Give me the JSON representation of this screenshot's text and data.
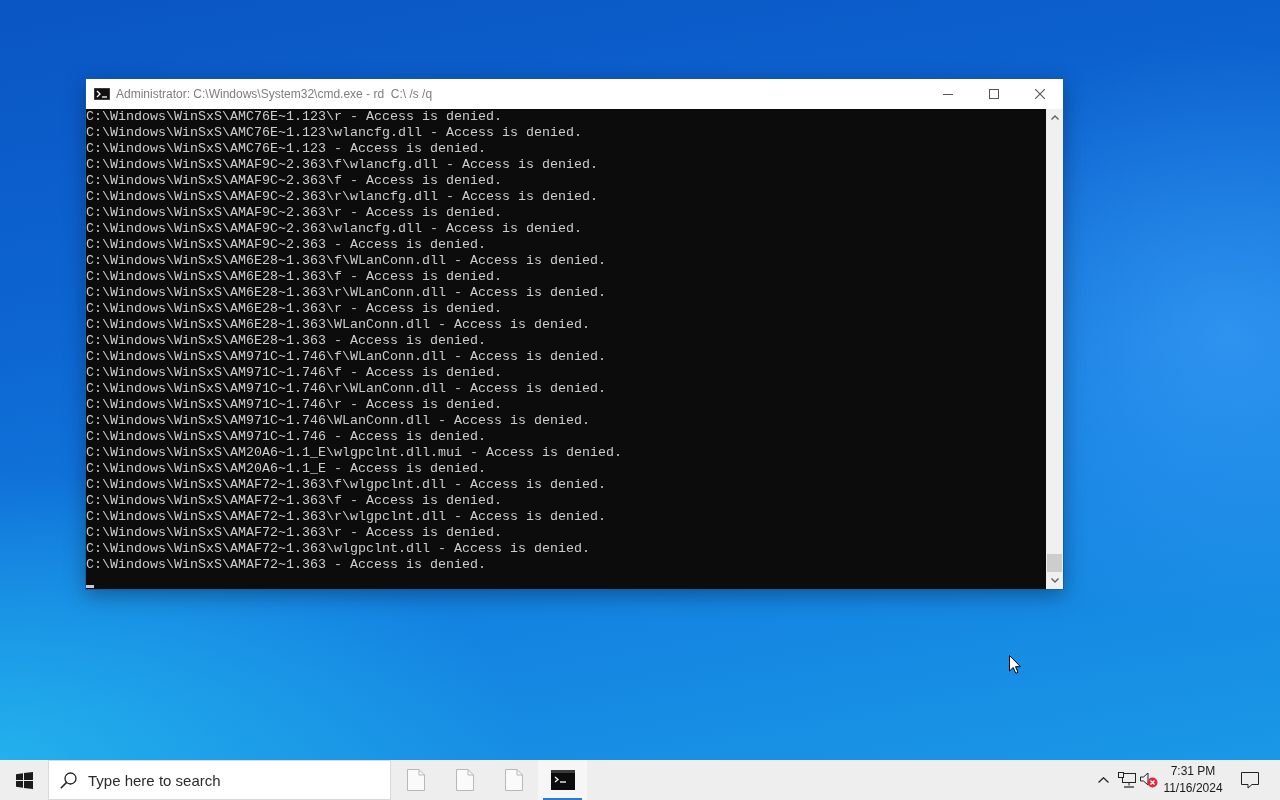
{
  "window": {
    "title": "Administrator: C:\\Windows\\System32\\cmd.exe - rd  C:\\ /s /q",
    "console_lines": [
      "C:\\Windows\\WinSxS\\AMC76E~1.123\\r - Access is denied.",
      "C:\\Windows\\WinSxS\\AMC76E~1.123\\wlancfg.dll - Access is denied.",
      "C:\\Windows\\WinSxS\\AMC76E~1.123 - Access is denied.",
      "C:\\Windows\\WinSxS\\AMAF9C~2.363\\f\\wlancfg.dll - Access is denied.",
      "C:\\Windows\\WinSxS\\AMAF9C~2.363\\f - Access is denied.",
      "C:\\Windows\\WinSxS\\AMAF9C~2.363\\r\\wlancfg.dll - Access is denied.",
      "C:\\Windows\\WinSxS\\AMAF9C~2.363\\r - Access is denied.",
      "C:\\Windows\\WinSxS\\AMAF9C~2.363\\wlancfg.dll - Access is denied.",
      "C:\\Windows\\WinSxS\\AMAF9C~2.363 - Access is denied.",
      "C:\\Windows\\WinSxS\\AM6E28~1.363\\f\\WLanConn.dll - Access is denied.",
      "C:\\Windows\\WinSxS\\AM6E28~1.363\\f - Access is denied.",
      "C:\\Windows\\WinSxS\\AM6E28~1.363\\r\\WLanConn.dll - Access is denied.",
      "C:\\Windows\\WinSxS\\AM6E28~1.363\\r - Access is denied.",
      "C:\\Windows\\WinSxS\\AM6E28~1.363\\WLanConn.dll - Access is denied.",
      "C:\\Windows\\WinSxS\\AM6E28~1.363 - Access is denied.",
      "C:\\Windows\\WinSxS\\AM971C~1.746\\f\\WLanConn.dll - Access is denied.",
      "C:\\Windows\\WinSxS\\AM971C~1.746\\f - Access is denied.",
      "C:\\Windows\\WinSxS\\AM971C~1.746\\r\\WLanConn.dll - Access is denied.",
      "C:\\Windows\\WinSxS\\AM971C~1.746\\r - Access is denied.",
      "C:\\Windows\\WinSxS\\AM971C~1.746\\WLanConn.dll - Access is denied.",
      "C:\\Windows\\WinSxS\\AM971C~1.746 - Access is denied.",
      "C:\\Windows\\WinSxS\\AM20A6~1.1_E\\wlgpclnt.dll.mui - Access is denied.",
      "C:\\Windows\\WinSxS\\AM20A6~1.1_E - Access is denied.",
      "C:\\Windows\\WinSxS\\AMAF72~1.363\\f\\wlgpclnt.dll - Access is denied.",
      "C:\\Windows\\WinSxS\\AMAF72~1.363\\f - Access is denied.",
      "C:\\Windows\\WinSxS\\AMAF72~1.363\\r\\wlgpclnt.dll - Access is denied.",
      "C:\\Windows\\WinSxS\\AMAF72~1.363\\r - Access is denied.",
      "C:\\Windows\\WinSxS\\AMAF72~1.363\\wlgpclnt.dll - Access is denied.",
      "C:\\Windows\\WinSxS\\AMAF72~1.363 - Access is denied."
    ]
  },
  "taskbar": {
    "search": {
      "placeholder": "Type here to search"
    },
    "apps": [
      {
        "kind": "file",
        "selected": false
      },
      {
        "kind": "file",
        "selected": false
      },
      {
        "kind": "file",
        "selected": false
      },
      {
        "kind": "terminal",
        "selected": true
      }
    ],
    "tray": {
      "volume_muted": true,
      "time": "7:31 PM",
      "date": "11/16/2024"
    }
  }
}
